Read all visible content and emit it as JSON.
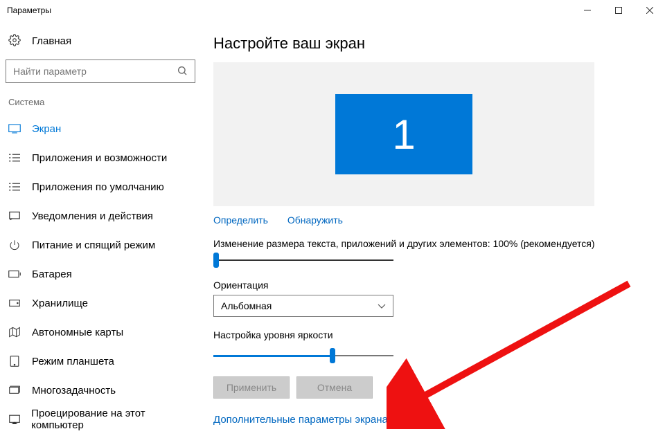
{
  "window": {
    "title": "Параметры"
  },
  "home": {
    "label": "Главная"
  },
  "search": {
    "placeholder": "Найти параметр"
  },
  "category": "Система",
  "nav": [
    {
      "label": "Экран"
    },
    {
      "label": "Приложения и возможности"
    },
    {
      "label": "Приложения по умолчанию"
    },
    {
      "label": "Уведомления и действия"
    },
    {
      "label": "Питание и спящий режим"
    },
    {
      "label": "Батарея"
    },
    {
      "label": "Хранилище"
    },
    {
      "label": "Автономные карты"
    },
    {
      "label": "Режим планшета"
    },
    {
      "label": "Многозадачность"
    },
    {
      "label": "Проецирование на этот компьютер"
    }
  ],
  "main": {
    "heading": "Настройте ваш экран",
    "display_number": "1",
    "identify_link": "Определить",
    "detect_link": "Обнаружить",
    "scale_label": "Изменение размера текста, приложений и других элементов: 100% (рекомендуется)",
    "orientation_label": "Ориентация",
    "orientation_value": "Альбомная",
    "brightness_label": "Настройка уровня яркости",
    "apply_btn": "Применить",
    "cancel_btn": "Отмена",
    "advanced_link": "Дополнительные параметры экрана"
  }
}
